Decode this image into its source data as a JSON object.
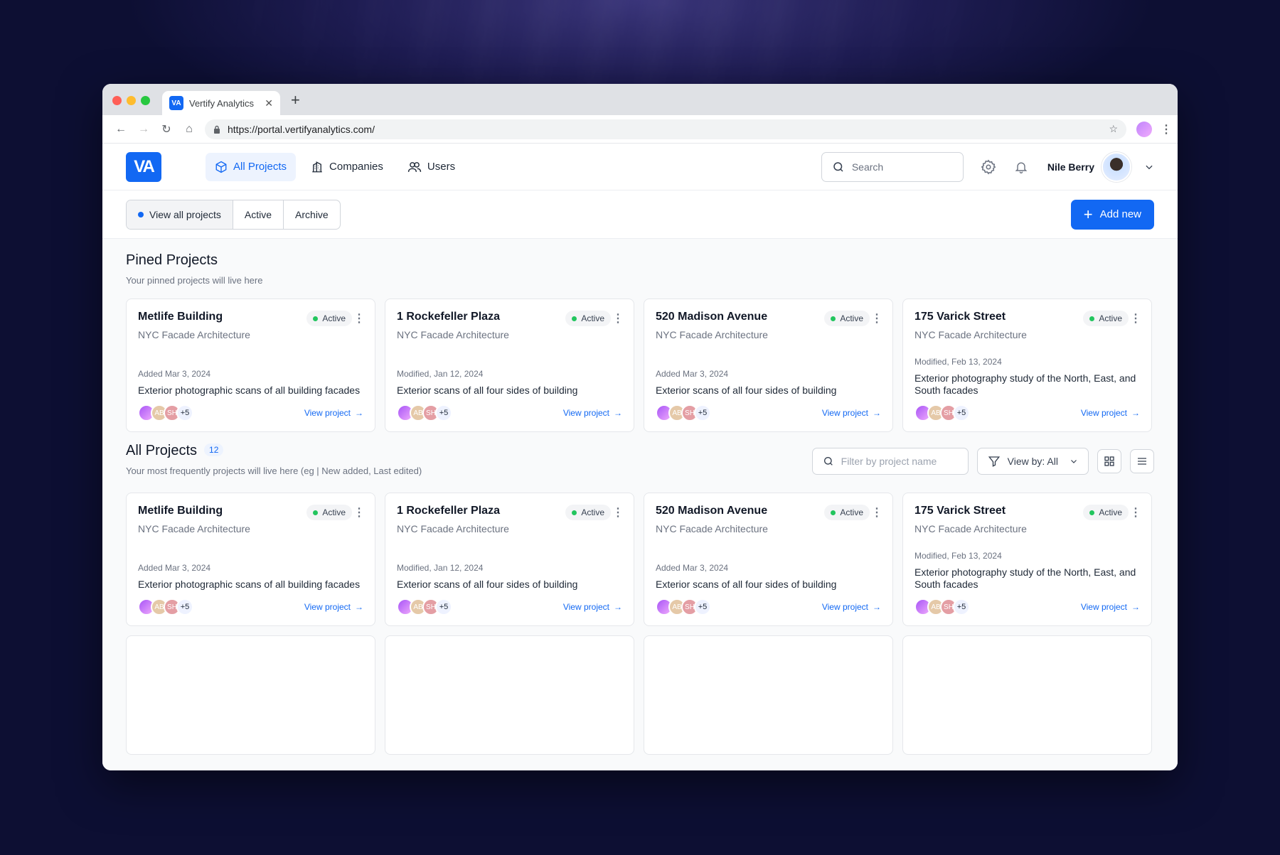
{
  "browser": {
    "tab_title": "Vertify Analytics",
    "tab_favicon": "VA",
    "url": "https://portal.vertifyanalytics.com/"
  },
  "app": {
    "logo": "VA",
    "nav": [
      {
        "label": "All Projects",
        "icon": "cube-icon",
        "active": true
      },
      {
        "label": "Companies",
        "icon": "building-icon",
        "active": false
      },
      {
        "label": "Users",
        "icon": "users-icon",
        "active": false
      }
    ],
    "search_placeholder": "Search",
    "user_name": "Nile Berry"
  },
  "toolbar": {
    "segments": [
      "View all projects",
      "Active",
      "Archive"
    ],
    "add_label": "Add new"
  },
  "pinned": {
    "title": "Pined Projects",
    "subtitle": "Your pinned projects will live here"
  },
  "all": {
    "title": "All Projects",
    "count": "12",
    "subtitle": "Your most frequently projects will live here (eg | New added, Last edited)",
    "filter_placeholder": "Filter by project name",
    "view_by": "View by: All"
  },
  "status_color": "#22c55e",
  "accent": "#1268f3",
  "projects": [
    {
      "name": "Metlife Building",
      "company": "NYC Facade Architecture",
      "status": "Active",
      "date": "Added Mar 3, 2024",
      "desc": "Exterior photographic scans of all building facades",
      "av2": "AB",
      "av3": "SH",
      "more": "+5",
      "link": "View project"
    },
    {
      "name": "1 Rockefeller Plaza",
      "company": "NYC Facade Architecture",
      "status": "Active",
      "date": "Modified, Jan 12, 2024",
      "desc": "Exterior scans of all four sides of building",
      "av2": "AB",
      "av3": "SH",
      "more": "+5",
      "link": "View project"
    },
    {
      "name": "520 Madison Avenue",
      "company": "NYC Facade Architecture",
      "status": "Active",
      "date": "Added Mar 3, 2024",
      "desc": "Exterior scans of all four sides of building",
      "av2": "AB",
      "av3": "SH",
      "more": "+5",
      "link": "View project"
    },
    {
      "name": "175 Varick Street",
      "company": "NYC Facade Architecture",
      "status": "Active",
      "date": "Modified, Feb 13, 2024",
      "desc": "Exterior photography study of the North, East, and South facades",
      "av2": "AB",
      "av3": "SH",
      "more": "+5",
      "link": "View project"
    }
  ]
}
